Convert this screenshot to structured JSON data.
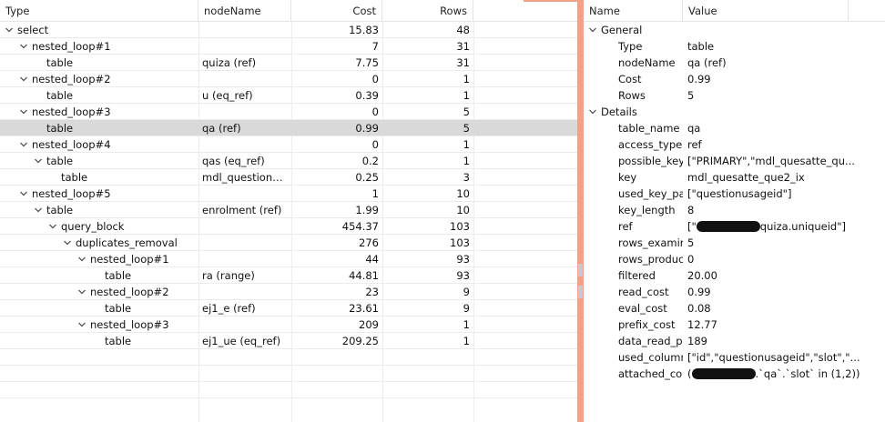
{
  "plan": {
    "columns": [
      "Type",
      "nodeName",
      "Cost",
      "Rows"
    ],
    "rows": [
      {
        "type": "select",
        "node": "",
        "cost": "15.83",
        "rows": "48",
        "level": 0,
        "expandable": true
      },
      {
        "type": "nested_loop#1",
        "node": "",
        "cost": "7",
        "rows": "31",
        "level": 1,
        "expandable": true
      },
      {
        "type": "table",
        "node": "quiza (ref)",
        "cost": "7.75",
        "rows": "31",
        "level": 2,
        "expandable": false
      },
      {
        "type": "nested_loop#2",
        "node": "",
        "cost": "0",
        "rows": "1",
        "level": 1,
        "expandable": true
      },
      {
        "type": "table",
        "node": "u (eq_ref)",
        "cost": "0.39",
        "rows": "1",
        "level": 2,
        "expandable": false
      },
      {
        "type": "nested_loop#3",
        "node": "",
        "cost": "0",
        "rows": "5",
        "level": 1,
        "expandable": true
      },
      {
        "type": "table",
        "node": "qa (ref)",
        "cost": "0.99",
        "rows": "5",
        "level": 2,
        "expandable": false,
        "selected": true
      },
      {
        "type": "nested_loop#4",
        "node": "",
        "cost": "0",
        "rows": "1",
        "level": 1,
        "expandable": true
      },
      {
        "type": "table",
        "node": "qas (eq_ref)",
        "cost": "0.2",
        "rows": "1",
        "level": 2,
        "expandable": true
      },
      {
        "type": "table",
        "node": "mdl_question_a...",
        "cost": "0.25",
        "rows": "3",
        "level": 3,
        "expandable": false
      },
      {
        "type": "nested_loop#5",
        "node": "",
        "cost": "1",
        "rows": "10",
        "level": 1,
        "expandable": true
      },
      {
        "type": "table",
        "node": "enrolment (ref)",
        "cost": "1.99",
        "rows": "10",
        "level": 2,
        "expandable": true
      },
      {
        "type": "query_block",
        "node": "",
        "cost": "454.37",
        "rows": "103",
        "level": 3,
        "expandable": true
      },
      {
        "type": "duplicates_removal",
        "node": "",
        "cost": "276",
        "rows": "103",
        "level": 4,
        "expandable": true
      },
      {
        "type": "nested_loop#1",
        "node": "",
        "cost": "44",
        "rows": "93",
        "level": 5,
        "expandable": true
      },
      {
        "type": "table",
        "node": "ra (range)",
        "cost": "44.81",
        "rows": "93",
        "level": 6,
        "expandable": false
      },
      {
        "type": "nested_loop#2",
        "node": "",
        "cost": "23",
        "rows": "9",
        "level": 5,
        "expandable": true
      },
      {
        "type": "table",
        "node": "ej1_e (ref)",
        "cost": "23.61",
        "rows": "9",
        "level": 6,
        "expandable": false
      },
      {
        "type": "nested_loop#3",
        "node": "",
        "cost": "209",
        "rows": "1",
        "level": 5,
        "expandable": true
      },
      {
        "type": "table",
        "node": "ej1_ue (eq_ref)",
        "cost": "209.25",
        "rows": "1",
        "level": 6,
        "expandable": false
      }
    ],
    "empty_rows": 3
  },
  "props": {
    "columns": [
      "Name",
      "Value"
    ],
    "rows": [
      {
        "kind": "group",
        "name": "General"
      },
      {
        "kind": "prop",
        "name": "Type",
        "value": "table"
      },
      {
        "kind": "prop",
        "name": "nodeName",
        "value": "qa (ref)"
      },
      {
        "kind": "prop",
        "name": "Cost",
        "value": "0.99"
      },
      {
        "kind": "prop",
        "name": "Rows",
        "value": "5"
      },
      {
        "kind": "group",
        "name": "Details"
      },
      {
        "kind": "prop",
        "name": "table_name",
        "value": "qa"
      },
      {
        "kind": "prop",
        "name": "access_type",
        "value": "ref"
      },
      {
        "kind": "prop",
        "name": "possible_keys",
        "value": "[\"PRIMARY\",\"mdl_quesatte_qu..."
      },
      {
        "kind": "prop",
        "name": "key",
        "value": "mdl_quesatte_que2_ix"
      },
      {
        "kind": "prop",
        "name": "used_key_par",
        "value": "[\"questionusageid\"]"
      },
      {
        "kind": "prop",
        "name": "key_length",
        "value": "8"
      },
      {
        "kind": "prop",
        "name": "ref",
        "value_before": "[\"",
        "value": "quiza.uniqueid\"]",
        "redacted": true
      },
      {
        "kind": "prop",
        "name": "rows_examine",
        "value": "5"
      },
      {
        "kind": "prop",
        "name": "rows_produce",
        "value": "0"
      },
      {
        "kind": "prop",
        "name": "filtered",
        "value": "20.00"
      },
      {
        "kind": "prop",
        "name": "read_cost",
        "value": "0.99"
      },
      {
        "kind": "prop",
        "name": "eval_cost",
        "value": "0.08"
      },
      {
        "kind": "prop",
        "name": "prefix_cost",
        "value": "12.77"
      },
      {
        "kind": "prop",
        "name": "data_read_per",
        "value": "189"
      },
      {
        "kind": "prop",
        "name": "used_column",
        "value": "[\"id\",\"questionusageid\",\"slot\",\"..."
      },
      {
        "kind": "prop",
        "name": "attached_con",
        "value_before": "(",
        "value": ".`qa`.`slot` in (1,2))",
        "redacted": true
      }
    ]
  },
  "colors": {
    "splitter": "#f1a185",
    "selected_row": "#d9d9d9"
  },
  "icons": {
    "expanded": "chevron-down-icon"
  }
}
